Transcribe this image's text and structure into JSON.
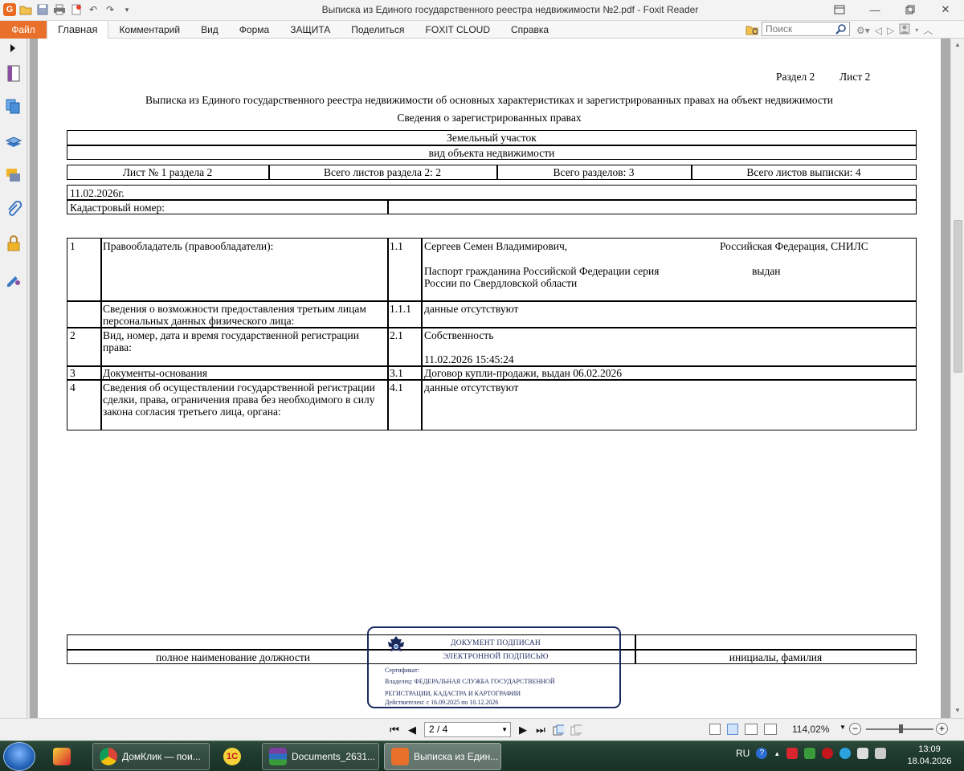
{
  "window": {
    "title": "Выписка из Единого государственного реестра недвижимости №2.pdf - Foxit Reader"
  },
  "menu": {
    "file": "Файл",
    "items": [
      "Главная",
      "Комментарий",
      "Вид",
      "Форма",
      "ЗАЩИТА",
      "Поделиться",
      "FOXIT CLOUD",
      "Справка"
    ],
    "search_placeholder": "Поиск"
  },
  "document": {
    "header_right": {
      "section": "Раздел 2",
      "sheet": "Лист 2"
    },
    "title": "Выписка из Единого государственного реестра недвижимости об основных характеристиках и зарегистрированных правах на объект недвижимости",
    "subtitle": "Сведения о зарегистрированных правах",
    "object_type_value": "Земельный участок",
    "object_type_caption": "вид объекта недвижимости",
    "sheet_info": [
      "Лист № 1 раздела 2",
      "Всего листов раздела 2: 2",
      "Всего разделов: 3",
      "Всего листов выписки: 4"
    ],
    "date": "11.02.2026г.",
    "cadastral_label": "Кадастровый номер:",
    "cadastral_value": "",
    "rows": [
      {
        "num": "1",
        "label": "Правообладатель (правообладатели):",
        "code": "1.1",
        "line1": "Сергеев Семен Владимирович,",
        "line1_right": "Российская Федерация, СНИЛС",
        "line2": "Паспорт гражданина Российской Федерации серия",
        "line2_right": "выдан",
        "line3": "России по Свердловской области"
      },
      {
        "num": "",
        "label": "Сведения о возможности предоставления третьим лицам персональных данных физического лица:",
        "code": "1.1.1",
        "value": "данные отсутствуют"
      },
      {
        "num": "2",
        "label": "Вид, номер, дата и время государственной регистрации права:",
        "code": "2.1",
        "value": "Собственность",
        "value2": "11.02.2026 15:45:24"
      },
      {
        "num": "3",
        "label": "Документы-основания",
        "code": "3.1",
        "value": "Договор купли-продажи, выдан 06.02.2026"
      },
      {
        "num": "4",
        "label": "Сведения об осуществлении государственной регистрации сделки, права, ограничения права без необходимого в силу закона согласия третьего лица, органа:",
        "code": "4.1",
        "value": "данные отсутствуют"
      }
    ],
    "footer": {
      "position_caption": "полное наименование должности",
      "name_caption": "инициалы, фамилия"
    },
    "stamp": {
      "line1": "ДОКУМЕНТ ПОДПИСАН",
      "line2": "ЭЛЕКТРОННОЙ ПОДПИСЬЮ",
      "cert": "Сертификат:",
      "owner": "Владелец: ФЕДЕРАЛЬНАЯ СЛУЖБА ГОСУДАРСТВЕННОЙ",
      "owner2": "РЕГИСТРАЦИИ, КАДАСТРА И КАРТОГРАФИИ",
      "valid": "Действителен: с 16.09.2025 по 10.12.2026"
    }
  },
  "statusbar": {
    "page": "2 / 4",
    "zoom": "114,02%"
  },
  "taskbar": {
    "items": [
      "ДомКлик — пои...",
      "Documents_2631...",
      "Выписка из Един..."
    ],
    "lang": "RU",
    "time": "13:09",
    "date": "18.04.2026"
  },
  "colors": {
    "accent": "#e8702a",
    "stamp": "#1b2a5e"
  }
}
